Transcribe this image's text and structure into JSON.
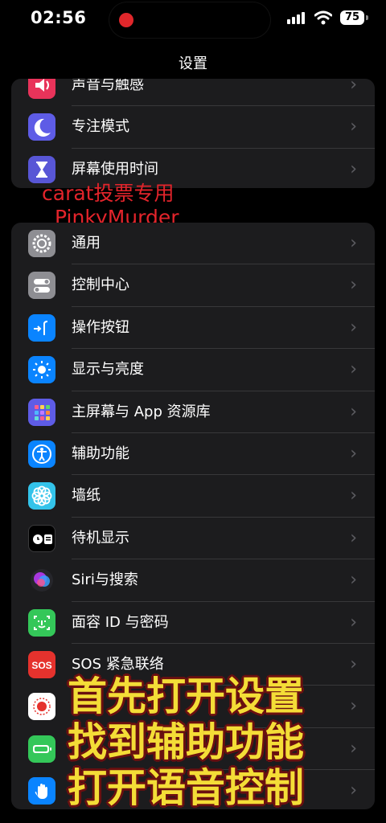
{
  "status": {
    "time": "02:56",
    "battery": "75"
  },
  "nav": {
    "title": "设置"
  },
  "group1": [
    {
      "label": "声音与触感",
      "icon": "speaker-icon",
      "color": "#e8335a"
    },
    {
      "label": "专注模式",
      "icon": "moon-icon",
      "color": "#5e5ce6"
    },
    {
      "label": "屏幕使用时间",
      "icon": "hourglass-icon",
      "color": "#5856d6"
    }
  ],
  "watermark": {
    "line1": "carat投票专用",
    "line2": "PinkyMurder"
  },
  "group2": [
    {
      "label": "通用",
      "icon": "gear-icon",
      "color": "#8e8e93"
    },
    {
      "label": "控制中心",
      "icon": "toggles-icon",
      "color": "#8e8e93"
    },
    {
      "label": "操作按钮",
      "icon": "action-button-icon",
      "color": "#0a84ff"
    },
    {
      "label": "显示与亮度",
      "icon": "sun-icon",
      "color": "#0a84ff"
    },
    {
      "label": "主屏幕与 App 资源库",
      "icon": "home-grid-icon",
      "color": "#5e5ce6"
    },
    {
      "label": "辅助功能",
      "icon": "accessibility-icon",
      "color": "#0a84ff"
    },
    {
      "label": "墙纸",
      "icon": "flower-icon",
      "color": "#33c3ea"
    },
    {
      "label": "待机显示",
      "icon": "standby-icon",
      "color": "#000000"
    },
    {
      "label": "Siri与搜索",
      "icon": "siri-icon",
      "color": "#1c1c1e"
    },
    {
      "label": "面容 ID 与密码",
      "icon": "faceid-icon",
      "color": "#34c759"
    },
    {
      "label": "SOS 紧急联络",
      "icon": "sos-icon",
      "color": "#e5322d"
    },
    {
      "label": "",
      "icon": "exposure-icon",
      "color": "#ffffff"
    },
    {
      "label": "",
      "icon": "battery-icon",
      "color": "#34c759"
    },
    {
      "label": "",
      "icon": "privacy-hand-icon",
      "color": "#0a84ff"
    }
  ],
  "overlay": [
    "首先打开设置",
    "找到辅助功能",
    "打开语音控制"
  ]
}
